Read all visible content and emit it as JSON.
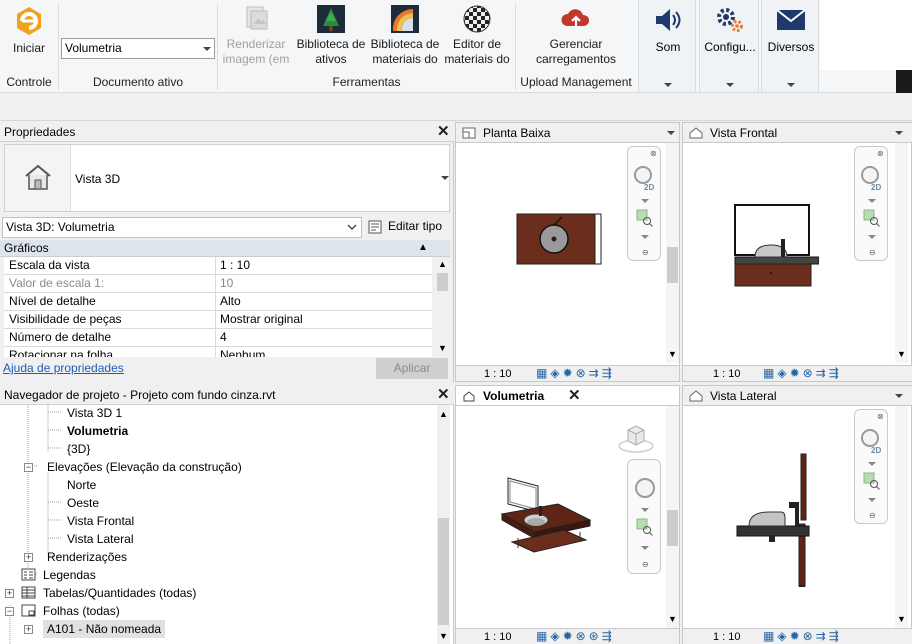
{
  "ribbon": {
    "iniciar": "Iniciar",
    "doc_select": "Volumetria",
    "renderizar": "Renderizar imagem (em",
    "bib_ativos": "Biblioteca de ativos",
    "bib_materiais": "Biblioteca de materiais do",
    "editor_materiais": "Editor de materiais do",
    "gerenciar": "Gerenciar carregamentos",
    "som": "Som",
    "config": "Configu...",
    "diversos": "Diversos",
    "groups": {
      "controle": "Controle",
      "documento": "Documento ativo",
      "ferramentas": "Ferramentas",
      "upload": "Upload Management"
    }
  },
  "properties": {
    "title": "Propriedades",
    "type_name": "Vista 3D",
    "type_select": "Vista 3D: Volumetria",
    "edit_type": "Editar tipo",
    "section": "Gráficos",
    "rows": [
      {
        "k": "Escala da vista",
        "v": "1 : 10"
      },
      {
        "k": "Valor de escala    1:",
        "v": "10"
      },
      {
        "k": "Nível de detalhe",
        "v": "Alto"
      },
      {
        "k": "Visibilidade de peças",
        "v": "Mostrar original"
      },
      {
        "k": "Número de detalhe",
        "v": "4"
      },
      {
        "k": "Rotacionar na folha",
        "v": "Nenhum"
      }
    ],
    "help": "Ajuda de propriedades",
    "apply": "Aplicar"
  },
  "navigator": {
    "title": "Navegador de projeto - Projeto com fundo cinza.rvt",
    "items": {
      "vista3d1": "Vista 3D 1",
      "volumetria": "Volumetria",
      "tres_d": "{3D}",
      "elevacoes": "Elevações (Elevação da construção)",
      "norte": "Norte",
      "oeste": "Oeste",
      "vista_frontal": "Vista Frontal",
      "vista_lateral": "Vista Lateral",
      "renderizacoes": "Renderizações",
      "legendas": "Legendas",
      "tabelas": "Tabelas/Quantidades (todas)",
      "folhas": "Folhas (todas)",
      "a101": "A101 - Não nomeada"
    }
  },
  "views": {
    "planta": {
      "title": "Planta Baixa",
      "scale": "1 : 10"
    },
    "frontal": {
      "title": "Vista Frontal",
      "scale": "1 : 10"
    },
    "volumetria": {
      "title": "Volumetria",
      "scale": "1 : 10"
    },
    "lateral": {
      "title": "Vista Lateral",
      "scale": "1 : 10"
    },
    "nav_2d": "2D"
  }
}
